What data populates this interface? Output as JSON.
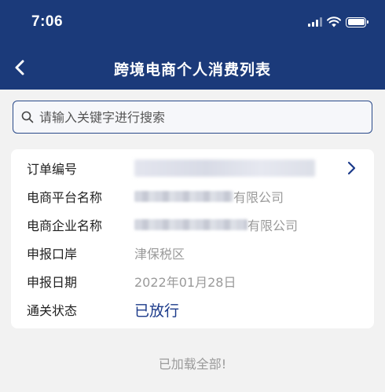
{
  "status_bar": {
    "time": "7:06"
  },
  "nav": {
    "title": "跨境电商个人消费列表"
  },
  "search": {
    "placeholder": "请输入关键字进行搜索"
  },
  "record": {
    "order_no_label": "订单编号",
    "platform_label": "电商平台名称",
    "platform_suffix": "有限公司",
    "enterprise_label": "电商企业名称",
    "enterprise_suffix": "有限公司",
    "port_label": "申报口岸",
    "port_value": "津保税区",
    "date_label": "申报日期",
    "date_value": "2022年01月28日",
    "status_label": "通关状态",
    "status_value": "已放行"
  },
  "footer": {
    "loaded_text": "已加载全部!"
  },
  "colors": {
    "header_bg": "#1b3a7a",
    "accent": "#1b3a8a",
    "page_bg": "#f2f2f2"
  },
  "icons": [
    "back-arrow-icon",
    "search-icon",
    "chevron-right-icon",
    "signal-icon",
    "wifi-icon",
    "battery-icon"
  ]
}
